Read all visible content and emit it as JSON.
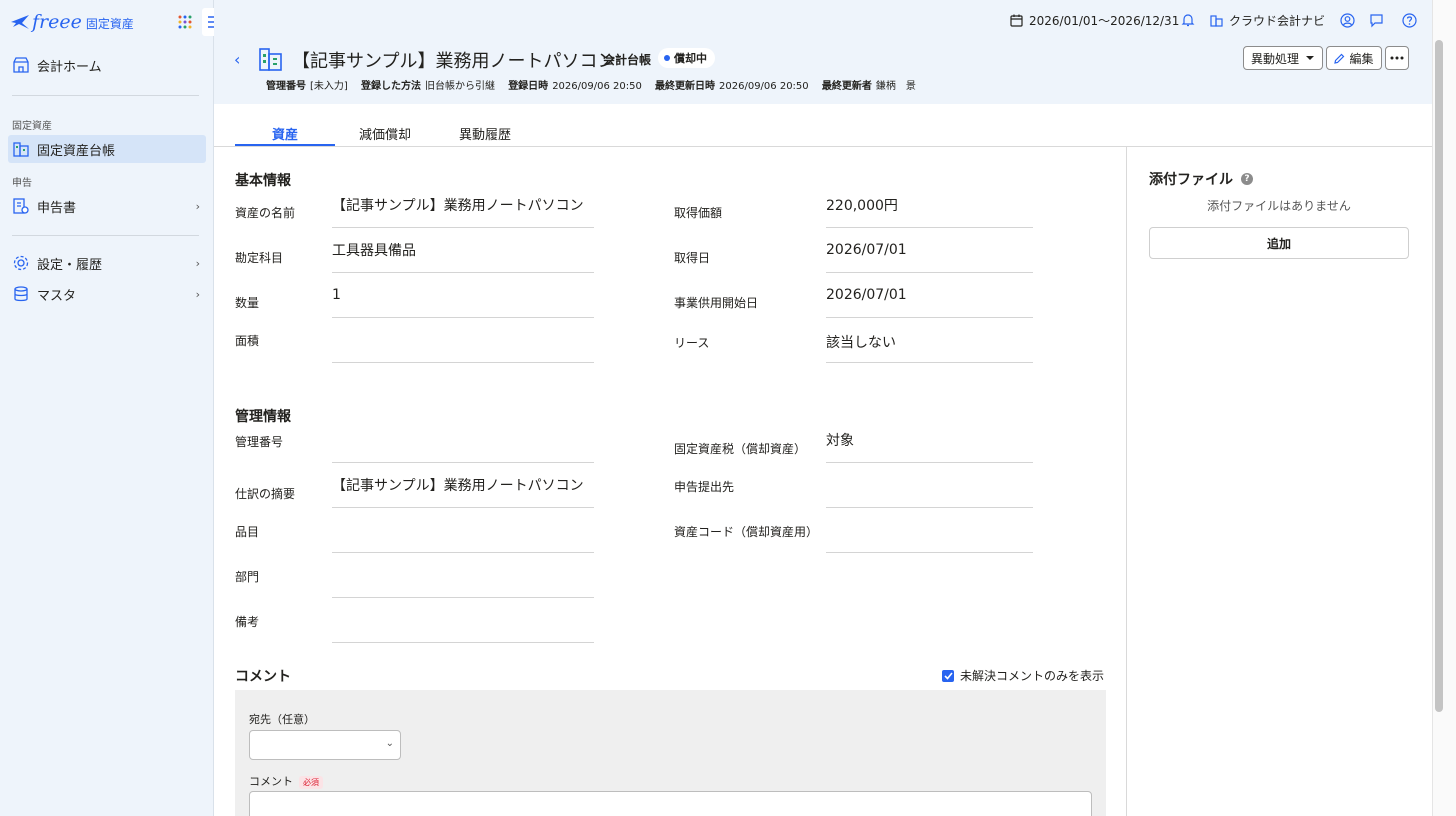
{
  "sidebar": {
    "brand": "freee",
    "product": "固定資産",
    "home_label": "会計ホーム",
    "section_fixed_assets": "固定資産",
    "ledger_label": "固定資産台帳",
    "section_filing": "申告",
    "filing_label": "申告書",
    "settings_label": "設定・履歴",
    "master_label": "マスタ"
  },
  "topbar": {
    "period": "2026/01/01〜2026/12/31",
    "cloud_nav": "クラウド会計ナビ"
  },
  "header": {
    "title": "【記事サンプル】業務用ノートパソコン",
    "ledger": "会計台帳",
    "status": "償却中",
    "meta": {
      "mgmt_no_label": "管理番号",
      "mgmt_no_value": "[未入力]",
      "reg_method_label": "登録した方法",
      "reg_method_value": "旧台帳から引継",
      "reg_date_label": "登録日時",
      "reg_date_value": "2026/09/06 20:50",
      "updated_label": "最終更新日時",
      "updated_value": "2026/09/06 20:50",
      "updater_label": "最終更新者",
      "updater_value": "鎌柄　景"
    },
    "actions": {
      "transfer": "異動処理",
      "edit": "編集"
    }
  },
  "tabs": [
    "資産",
    "減価償却",
    "異動履歴"
  ],
  "basic_info": {
    "title": "基本情報",
    "left": [
      {
        "label": "資産の名前",
        "value": "【記事サンプル】業務用ノートパソコン"
      },
      {
        "label": "勘定科目",
        "value": "工具器具備品"
      },
      {
        "label": "数量",
        "value": "1"
      },
      {
        "label": "面積",
        "value": ""
      }
    ],
    "right": [
      {
        "label": "取得価額",
        "value": "220,000円"
      },
      {
        "label": "取得日",
        "value": "2026/07/01"
      },
      {
        "label": "事業供用開始日",
        "value": "2026/07/01"
      },
      {
        "label": "リース",
        "value": "該当しない"
      }
    ]
  },
  "management_info": {
    "title": "管理情報",
    "left": [
      {
        "label": "管理番号",
        "value": ""
      },
      {
        "label": "仕訳の摘要",
        "value": "【記事サンプル】業務用ノートパソコン"
      },
      {
        "label": "品目",
        "value": ""
      },
      {
        "label": "部門",
        "value": ""
      },
      {
        "label": "備考",
        "value": ""
      }
    ],
    "right": [
      {
        "label": "固定資産税（償却資産）",
        "value": "対象"
      },
      {
        "label": "申告提出先",
        "value": ""
      },
      {
        "label": "資産コード（償却資産用）",
        "value": ""
      }
    ]
  },
  "attachments": {
    "title": "添付ファイル",
    "help": "?",
    "empty": "添付ファイルはありません",
    "add": "追加"
  },
  "comments": {
    "title": "コメント",
    "filter_label": "未解決コメントのみを表示",
    "filter_checked": true,
    "to_label": "宛先（任意）",
    "comment_label": "コメント",
    "required": "必須"
  },
  "colors": {
    "accent": "#2864f0",
    "sidebar_bg": "#eef4fb"
  }
}
